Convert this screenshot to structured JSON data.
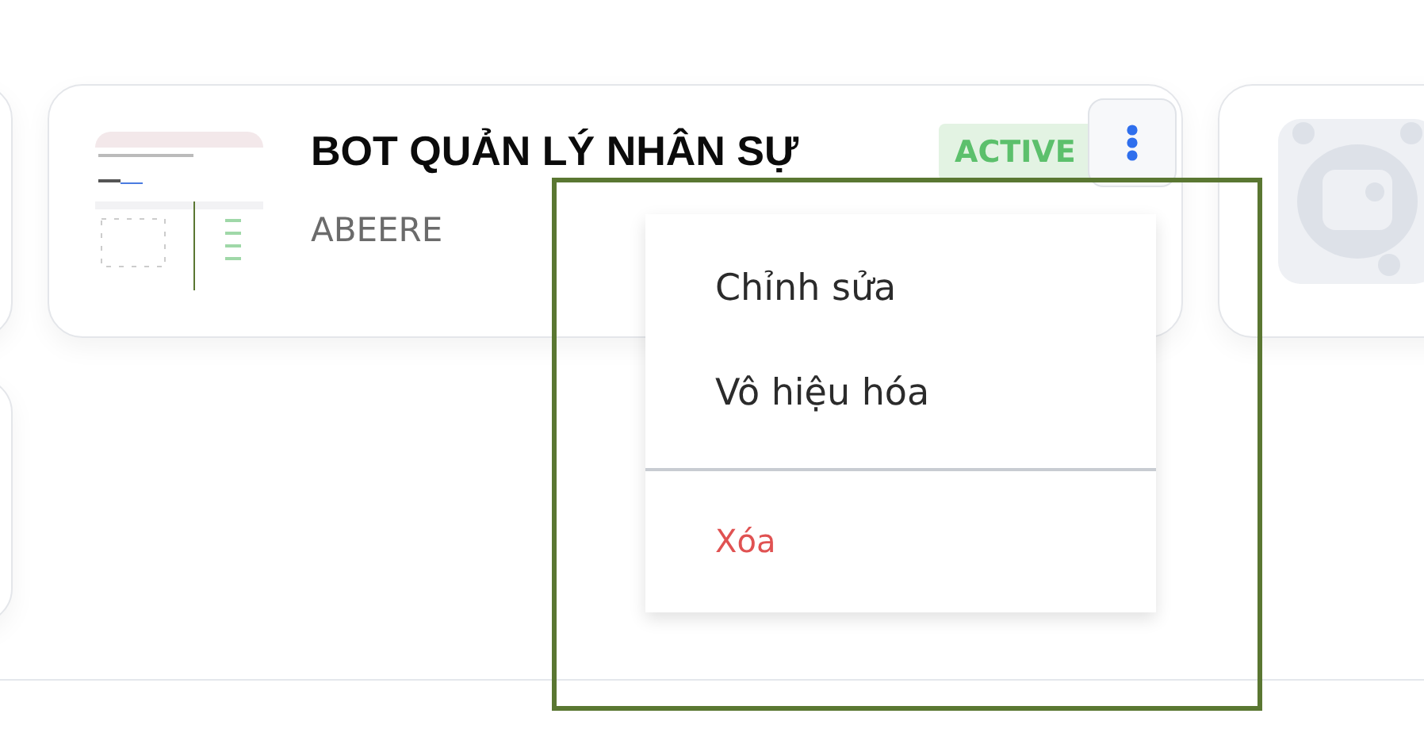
{
  "bot_card": {
    "title": "BOT QUẢN LÝ NHÂN SỰ",
    "owner": "ABEERE",
    "status": "ACTIVE"
  },
  "context_menu": {
    "items": [
      {
        "label": "Chỉnh sửa",
        "kind": "normal"
      },
      {
        "label": "Vô hiệu hóa",
        "kind": "normal"
      },
      {
        "label": "Xóa",
        "kind": "danger"
      }
    ]
  }
}
